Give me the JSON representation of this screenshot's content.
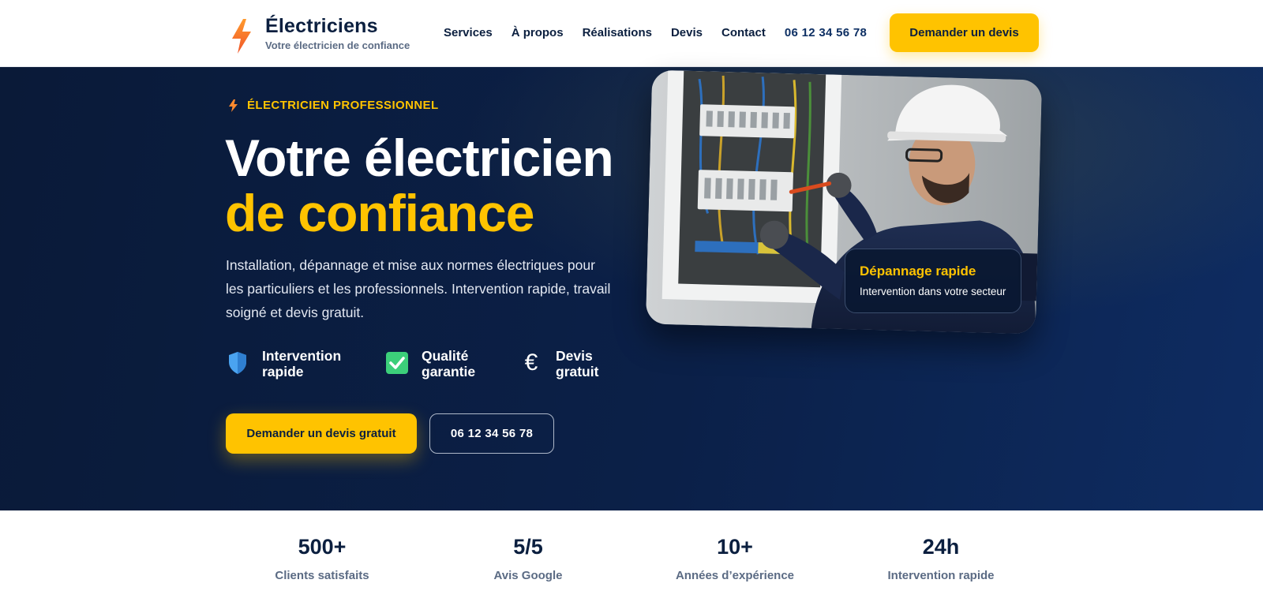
{
  "brand": {
    "name": "Électriciens",
    "tagline": "Votre électricien de confiance",
    "accent_color": "#ffc300",
    "navy_color": "#0b1f3f"
  },
  "nav": {
    "items": [
      "Services",
      "À propos",
      "Réalisations",
      "Devis",
      "Contact"
    ],
    "phone": "06 12 34 56 78",
    "cta_label": "Demander un devis"
  },
  "hero": {
    "eyebrow": "ÉLECTRICIEN PROFESSIONNEL",
    "title_line1": "Votre électricien",
    "title_line2": "de confiance",
    "lead": "Installation, dépannage et mise aux normes électriques pour les particuliers et les professionnels. Intervention rapide, travail soigné et devis gratuit.",
    "features": [
      {
        "icon": "shield-icon",
        "label": "Intervention rapide"
      },
      {
        "icon": "check-icon",
        "label": "Qualité garantie"
      },
      {
        "icon": "euro-icon",
        "label": "Devis gratuit"
      }
    ],
    "primary_cta": "Demander un devis gratuit",
    "phone_cta": "06 12 34 56 78",
    "card": {
      "title": "Dépannage rapide",
      "subtitle": "Intervention dans votre secteur"
    }
  },
  "stats": [
    {
      "value": "500+",
      "label": "Clients satisfaits"
    },
    {
      "value": "5/5",
      "label": "Avis Google"
    },
    {
      "value": "10+",
      "label": "Années d’expérience"
    },
    {
      "value": "24h",
      "label": "Intervention rapide"
    }
  ]
}
